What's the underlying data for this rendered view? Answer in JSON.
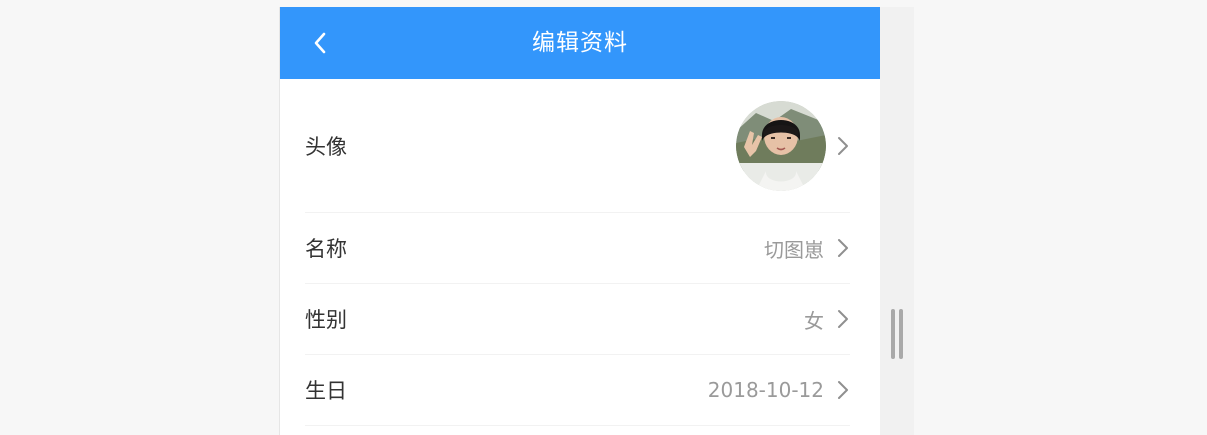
{
  "header": {
    "title": "编辑资料",
    "back_icon": "chevron-left-icon",
    "background": "#3396fb"
  },
  "profile": {
    "avatar_label": "头像",
    "rows": [
      {
        "label": "名称",
        "value": "切图崽"
      },
      {
        "label": "性别",
        "value": "女"
      },
      {
        "label": "生日",
        "value": "2018-10-12"
      }
    ]
  },
  "icons": {
    "row_chevron": "chevron-right-icon"
  }
}
